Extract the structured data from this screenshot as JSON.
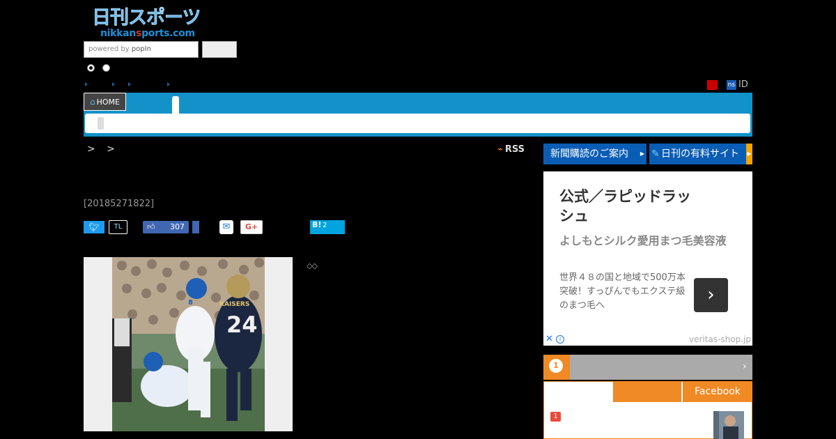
{
  "header": {
    "logo_text": "日刊スポーツ",
    "logo_domain_a": "nikkan",
    "logo_domain_b": "s",
    "logo_domain_c": "ports.com",
    "search_powered_by": "powered by",
    "search_brand": "popIn",
    "ns_badge": "ns",
    "id_label": "ID"
  },
  "nav": {
    "home_label": "HOME"
  },
  "article": {
    "breadcrumb": "> >",
    "rss_label": "RSS",
    "date": "[20185271822]",
    "diamonds": "◇◇"
  },
  "social": {
    "tl_label": "TL",
    "like_count": "307",
    "gplus_label": "G+",
    "hatena_label": "B!",
    "hatena_count": "2"
  },
  "sidebar": {
    "subscribe_label": "新聞購読のご案内",
    "paid_site_label": "日刊の有料サイト",
    "ad": {
      "title": "公式／ラピッドラッシュ",
      "subtitle": "よしもとシルク愛用まつ毛美容液",
      "body": "世界４８の国と地域で500万本突破！すっぴんでもエクステ級のまつ毛へ",
      "domain": "veritas-shop.jp"
    },
    "ranking": {
      "tab_facebook": "Facebook",
      "item_no": "1"
    }
  },
  "colors": {
    "nav_blue": "#1292c8",
    "brand_blue": "#0a5db5",
    "accent_orange": "#f08a24",
    "twitter": "#1d9bf0",
    "facebook": "#4267b2",
    "hatena": "#00a4de"
  }
}
